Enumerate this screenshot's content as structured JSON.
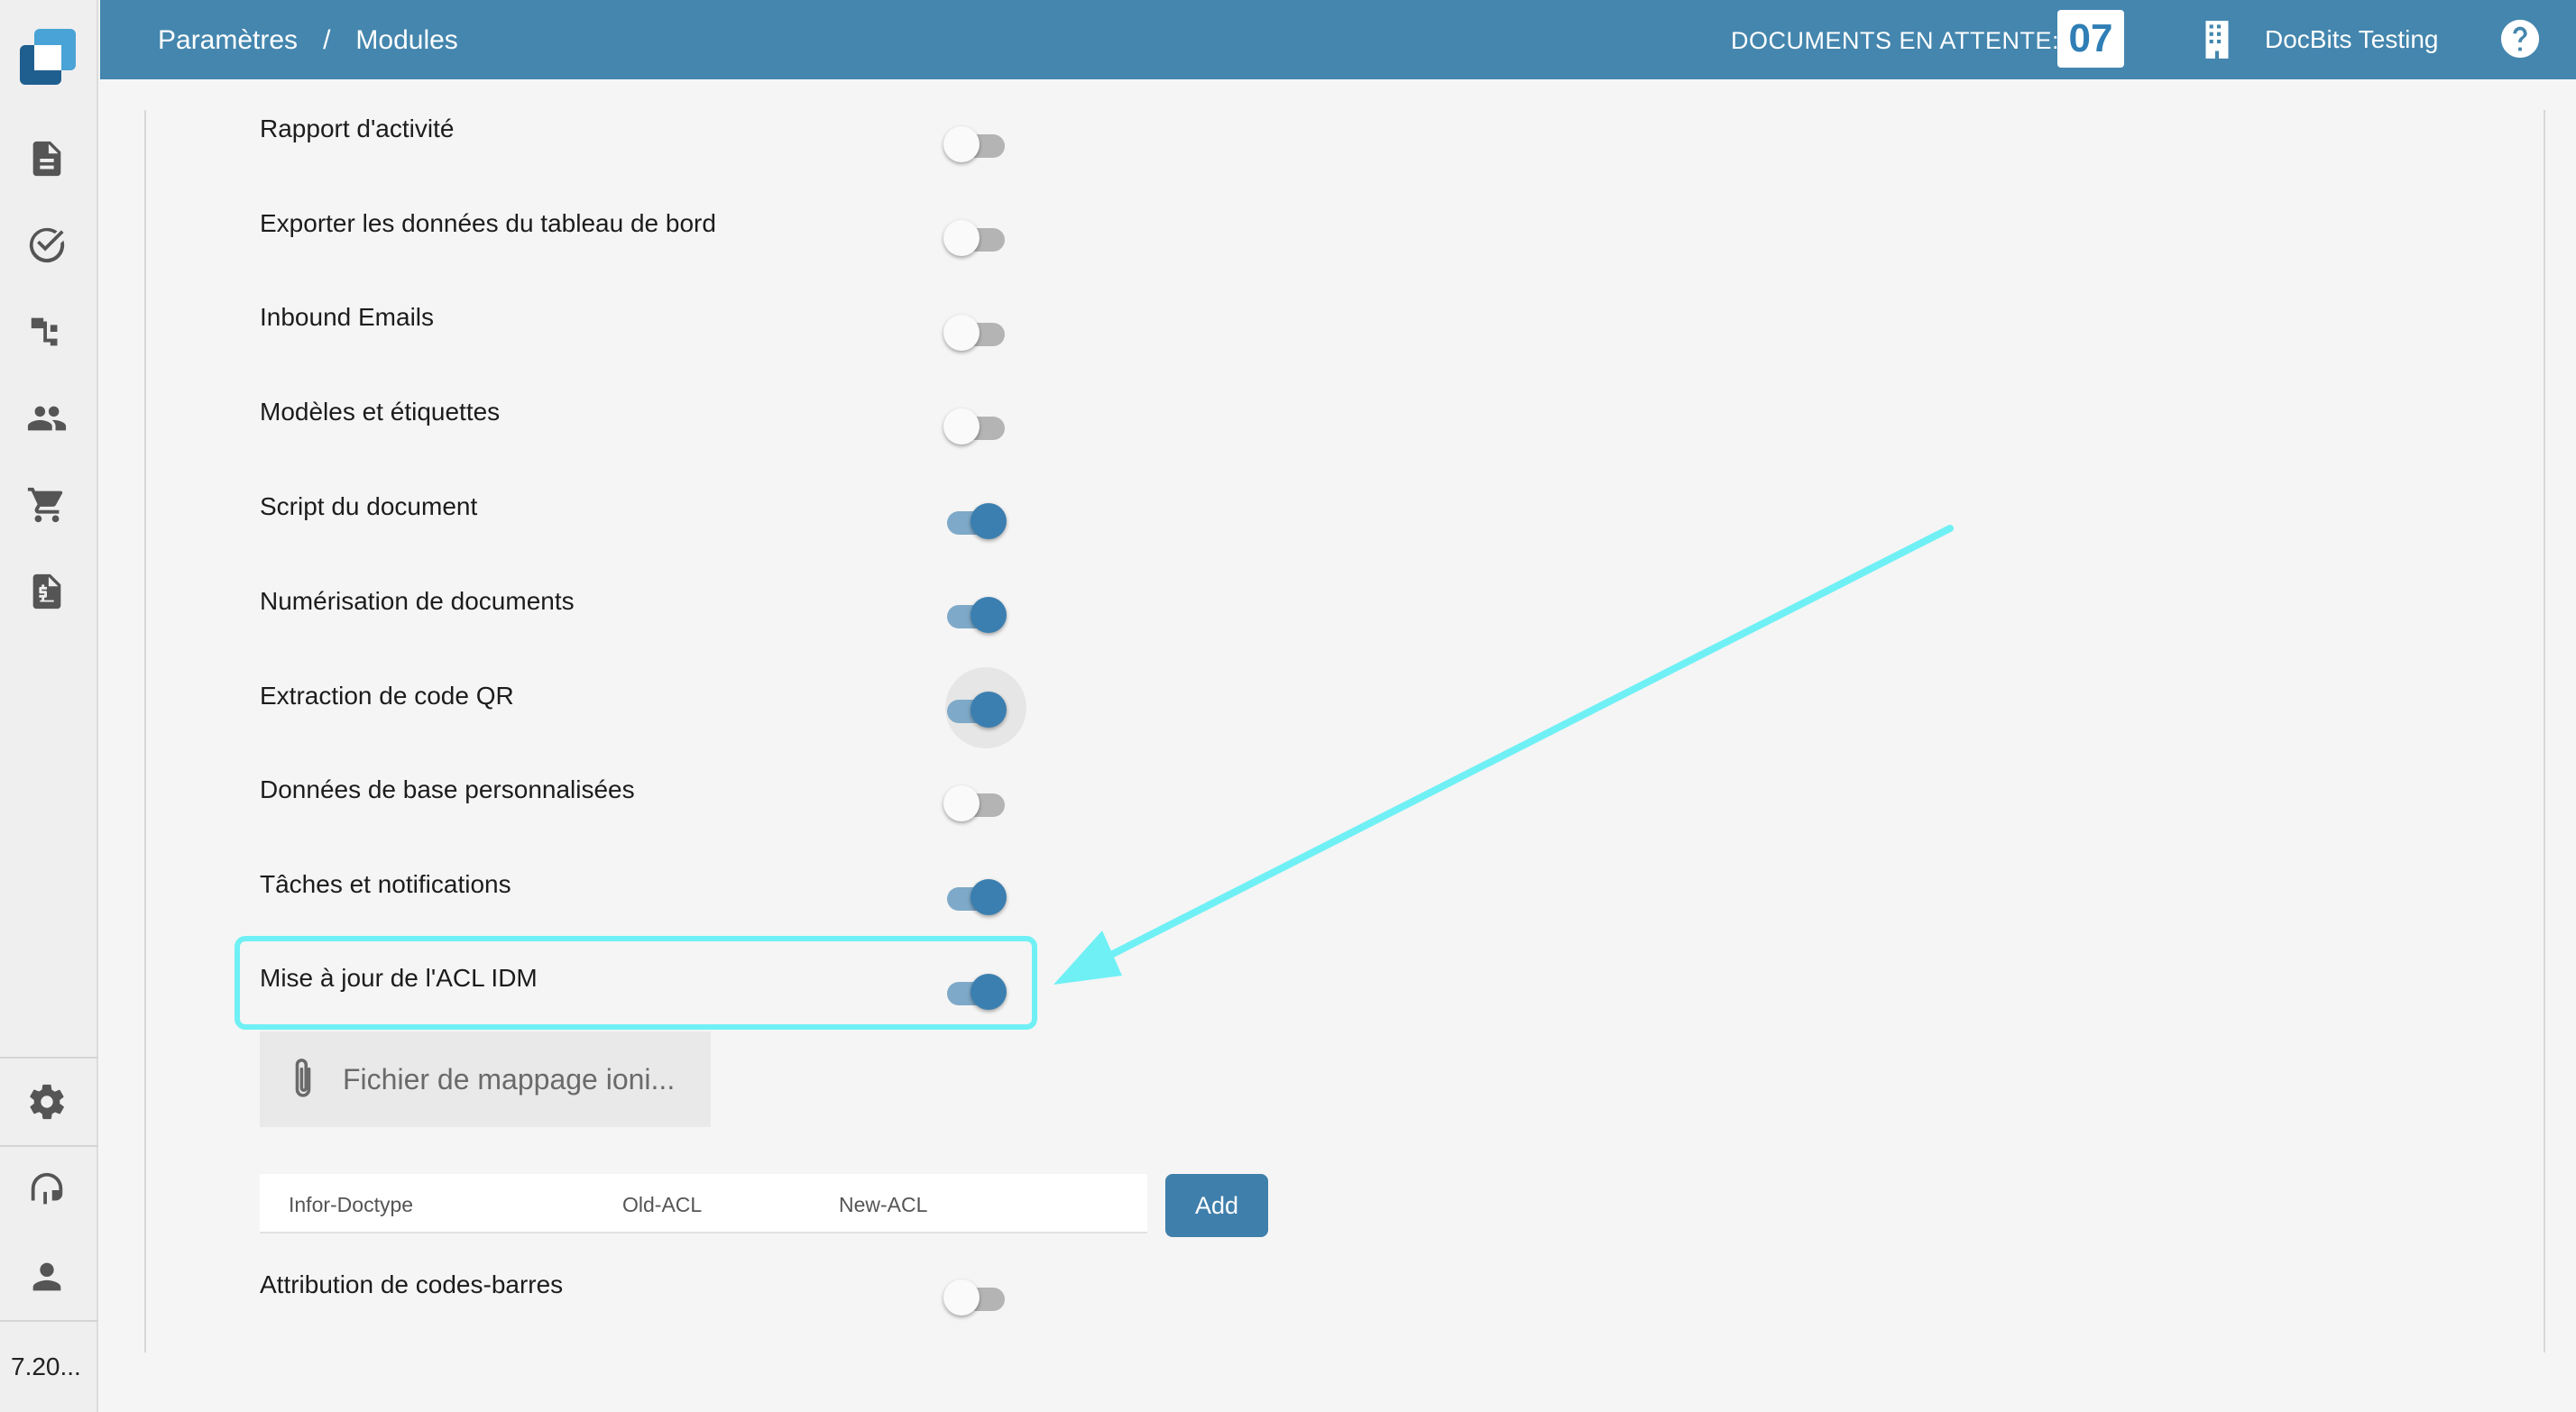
{
  "header": {
    "breadcrumb_parent": "Paramètres",
    "breadcrumb_sep": "/",
    "breadcrumb_current": "Modules",
    "pending_label": "DOCUMENTS EN ATTENTE:",
    "pending_count": "07",
    "company": "DocBits Testing"
  },
  "sidebar": {
    "items": [
      "document-icon",
      "check-circle-icon",
      "workflow-icon",
      "users-icon",
      "cart-icon",
      "invoice-icon"
    ],
    "bottom_items": [
      "settings-icon",
      "support-icon",
      "user-icon"
    ],
    "version": "7.20..."
  },
  "modules": [
    {
      "label": "Rapport d'activité",
      "enabled": false
    },
    {
      "label": "Exporter les données du tableau de bord",
      "enabled": false
    },
    {
      "label": "Inbound Emails",
      "enabled": false
    },
    {
      "label": "Modèles et étiquettes",
      "enabled": false
    },
    {
      "label": "Script du document",
      "enabled": true
    },
    {
      "label": "Numérisation de documents",
      "enabled": true
    },
    {
      "label": "Extraction de code QR",
      "enabled": true
    },
    {
      "label": "Données de base personnalisées",
      "enabled": false
    },
    {
      "label": "Tâches et notifications",
      "enabled": true
    },
    {
      "label": "Mise à jour de l'ACL IDM",
      "enabled": true
    },
    {
      "label": "Attribution de codes-barres",
      "enabled": false
    }
  ],
  "acl": {
    "file_button": "Fichier de mappage ioni...",
    "columns": [
      "Infor-Doctype",
      "Old-ACL",
      "New-ACL"
    ],
    "add_label": "Add"
  },
  "colors": {
    "header": "#4486ae",
    "toggle_on": "#3b7fb0",
    "highlight": "#6ff0f5"
  }
}
